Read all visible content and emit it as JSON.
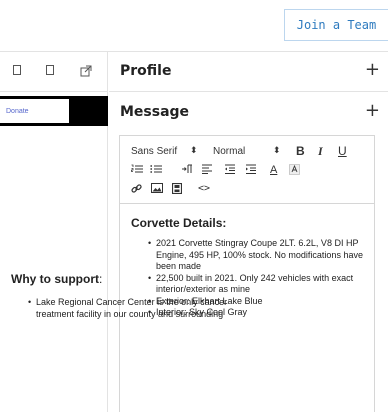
{
  "header": {
    "join_team_label": "Join a Team"
  },
  "left_panel": {
    "icons": [
      "mobile-icon",
      "tablet-icon",
      "external-link-icon"
    ],
    "donate_label": "Donate"
  },
  "sections": {
    "profile_title": "Profile",
    "message_title": "Message",
    "expand_symbol": "+"
  },
  "editor": {
    "toolbar": {
      "font_family": "Sans Serif",
      "font_size": "Normal",
      "bold": "B",
      "italic": "I",
      "underline": "U",
      "color_label": "A",
      "code_label": "<>"
    },
    "content": {
      "heading": "Corvette Details:",
      "bullets": [
        "2021 Corvette Stingray Coupe 2LT. 6.2L, V8 DI HP Engine, 495 HP, 100% stock. No modifications have been made",
        "22,500 built in 2021. Only 242 vehicles with exact interior/exterior as mine",
        "Exterior: Elkhart Lake Blue",
        "Interior: Sky Cool Gray"
      ],
      "why_heading": "Why to support",
      "why_colon": ":",
      "why_bullets": [
        "Lake Regional Cancer Center is the only cancer treatment facility in our county and surrounding"
      ]
    }
  },
  "colors": {
    "accent": "#2e7bbf",
    "border": "#e3e3e3"
  }
}
